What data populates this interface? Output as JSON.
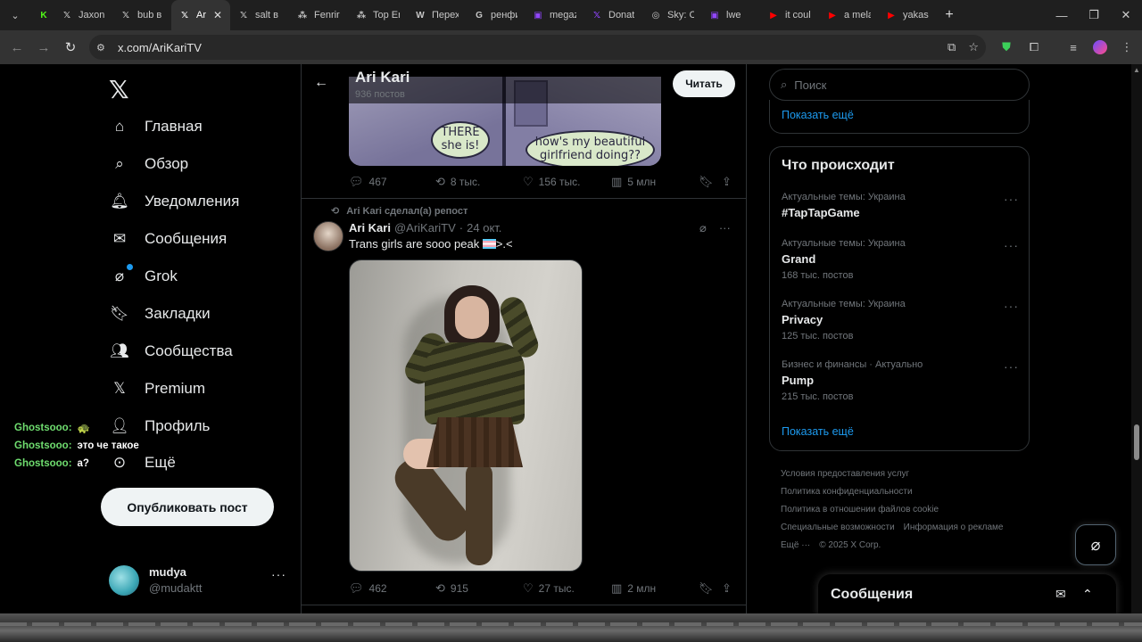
{
  "browser": {
    "tabs": [
      {
        "title": "",
        "favicon": "kick-logo-icon",
        "color": "#53fc18"
      },
      {
        "title": "Jaxonk",
        "favicon": "x-logo-icon"
      },
      {
        "title": "bub в",
        "favicon": "x-logo-icon"
      },
      {
        "title": "Ar",
        "favicon": "x-logo-icon",
        "active": true
      },
      {
        "title": "salt в",
        "favicon": "x-logo-icon"
      },
      {
        "title": "Fenrir",
        "favicon": "tc-logo-icon"
      },
      {
        "title": "Top En",
        "favicon": "tc-logo-icon"
      },
      {
        "title": "Перех",
        "favicon": "wikipedia-icon"
      },
      {
        "title": "ренфи",
        "favicon": "google-icon"
      },
      {
        "title": "megaz",
        "favicon": "twitch-icon",
        "color": "#9146ff"
      },
      {
        "title": "Donat",
        "favicon": "x-logo-icon",
        "color": "#9146ff"
      },
      {
        "title": "Sky: C",
        "favicon": "steam-icon"
      },
      {
        "title": "lwe",
        "favicon": "twitch-icon",
        "color": "#9146ff"
      },
      {
        "title": "it coul",
        "favicon": "youtube-icon",
        "color": "#ff0000"
      },
      {
        "title": "a mela",
        "favicon": "youtube-icon",
        "color": "#ff0000"
      },
      {
        "title": "yakas",
        "favicon": "youtube-icon",
        "color": "#ff0000"
      }
    ],
    "new_tab": "+",
    "url": "x.com/AriKariTV"
  },
  "nav": {
    "items": [
      {
        "label": "Главная",
        "icon": "home-icon"
      },
      {
        "label": "Обзор",
        "icon": "search-icon"
      },
      {
        "label": "Уведомления",
        "icon": "bell-icon"
      },
      {
        "label": "Сообщения",
        "icon": "mail-icon"
      },
      {
        "label": "Grok",
        "icon": "grok-icon"
      },
      {
        "label": "Закладки",
        "icon": "bookmark-icon"
      },
      {
        "label": "Сообщества",
        "icon": "communities-icon"
      },
      {
        "label": "Premium",
        "icon": "x-logo-icon"
      },
      {
        "label": "Профиль",
        "icon": "person-icon"
      },
      {
        "label": "Ещё",
        "icon": "more-circle-icon"
      }
    ],
    "post_button": "Опубликовать пост"
  },
  "account": {
    "name": "mudya",
    "handle": "@mudaktt"
  },
  "chat_overlay": [
    {
      "user": "Ghostsooo:",
      "text": "🐢"
    },
    {
      "user": "Ghostsooo:",
      "text": "это че такое"
    },
    {
      "user": "Ghostsooo:",
      "text": "а?"
    }
  ],
  "profile_header": {
    "title": "Ari Kari",
    "post_count": "936 постов",
    "follow_label": "Читать"
  },
  "comic": {
    "bubble1": "THERE she is!",
    "bubble2": "how's my beautiful girlfriend doing??"
  },
  "tweet1_stats": {
    "replies": "467",
    "reposts": "8 тыс.",
    "likes": "156 тыс.",
    "views": "5 млн"
  },
  "tweet2": {
    "repost_label": "Ari Kari сделал(а) репост",
    "author": "Ari Kari",
    "handle": "@AriKariTV",
    "date": "24 окт.",
    "text_before_flag": "Trans girls are sooo peak ",
    "text_after_flag": ">.<",
    "stats": {
      "replies": "462",
      "reposts": "915",
      "likes": "27 тыс.",
      "views": "2 млн"
    }
  },
  "search": {
    "placeholder": "Поиск"
  },
  "show_more": "Показать ещё",
  "trends": {
    "title": "Что происходит",
    "items": [
      {
        "context": "Актуальные темы: Украина",
        "name": "#TapTapGame",
        "count": ""
      },
      {
        "context": "Актуальные темы: Украина",
        "name": "Grand",
        "count": "168 тыс. постов"
      },
      {
        "context": "Актуальные темы: Украина",
        "name": "Privacy",
        "count": "125 тыс. постов"
      },
      {
        "context": "Бизнес и финансы · Актуально",
        "name": "Pump",
        "count": "215 тыс. постов"
      }
    ],
    "show_more": "Показать ещё"
  },
  "footer": {
    "links": [
      "Условия предоставления услуг",
      "Политика конфиденциальности",
      "Политика в отношении файлов cookie",
      "Специальные возможности",
      "Информация о рекламе",
      "Ещё ···",
      "© 2025 X Corp."
    ]
  },
  "messages_drawer": {
    "title": "Сообщения"
  }
}
